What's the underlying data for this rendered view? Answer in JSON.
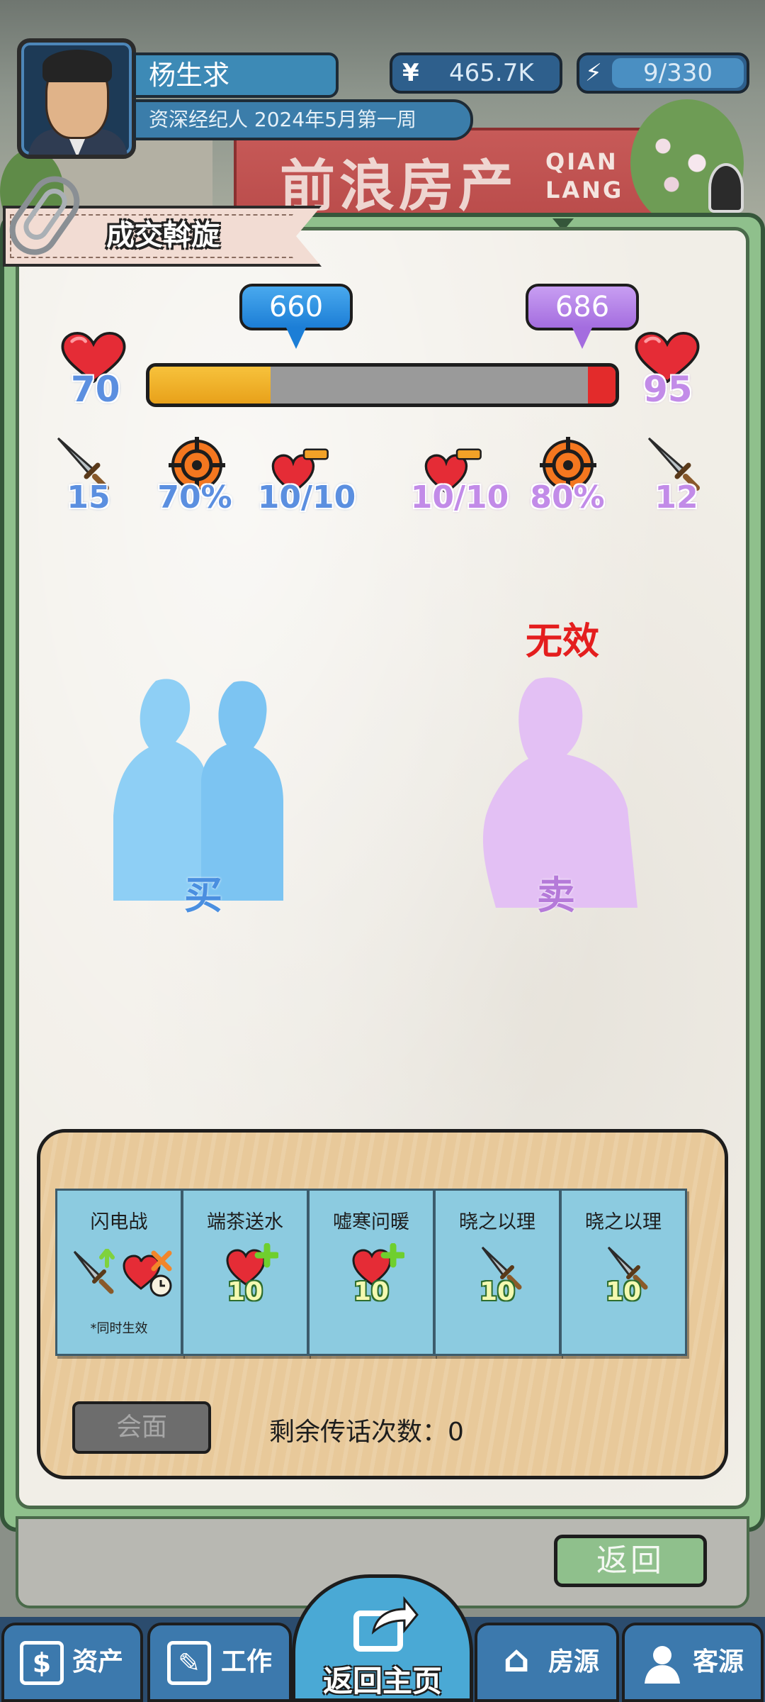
{
  "header": {
    "player_name": "杨生求",
    "player_subtitle": "资深经纪人 2024年5月第一周",
    "money_symbol": "¥",
    "money_value": "465.7K",
    "energy_value": "9/330"
  },
  "background": {
    "sign_text": "前浪房产",
    "sign_en_1": "QIAN",
    "sign_en_2": "LANG"
  },
  "panel": {
    "title": "成交斡旋"
  },
  "negotiation": {
    "buyer_price": "660",
    "seller_price": "686",
    "bar_left_fraction": 0.26,
    "bar_right_fraction": 0.06,
    "buyer_hp": "70",
    "seller_hp": "95",
    "buyer_stats": {
      "attack": "15",
      "crit": "70%",
      "heart": "10/10"
    },
    "seller_stats": {
      "heart": "10/10",
      "crit": "80%",
      "attack": "12"
    },
    "seller_status": "无效",
    "buyer_label": "买",
    "seller_label": "卖"
  },
  "cards": [
    {
      "title": "闪电战",
      "value": "",
      "note": "*同时生效",
      "icons": [
        "sword-up-icon",
        "heart-cross-icon",
        "clock-icon"
      ]
    },
    {
      "title": "端茶送水",
      "value": "10",
      "note": "",
      "icons": [
        "heart-plus-icon"
      ]
    },
    {
      "title": "嘘寒问暖",
      "value": "10",
      "note": "",
      "icons": [
        "heart-plus-icon"
      ]
    },
    {
      "title": "晓之以理",
      "value": "10",
      "note": "",
      "icons": [
        "sword-icon"
      ]
    },
    {
      "title": "晓之以理",
      "value": "10",
      "note": "",
      "icons": [
        "sword-icon"
      ]
    }
  ],
  "actions": {
    "meet_label": "会面",
    "remaining_label": "剩余传话次数：0",
    "back_label": "返回"
  },
  "nav": {
    "assets": "资产",
    "work": "工作",
    "home": "返回主页",
    "listings": "房源",
    "clients": "客源"
  },
  "colors": {
    "buyer": "#5b8fe0",
    "seller": "#c28be8",
    "bar_left": "#f2b52a",
    "bar_right": "#e32b2b",
    "invalid": "#e41e1e"
  }
}
